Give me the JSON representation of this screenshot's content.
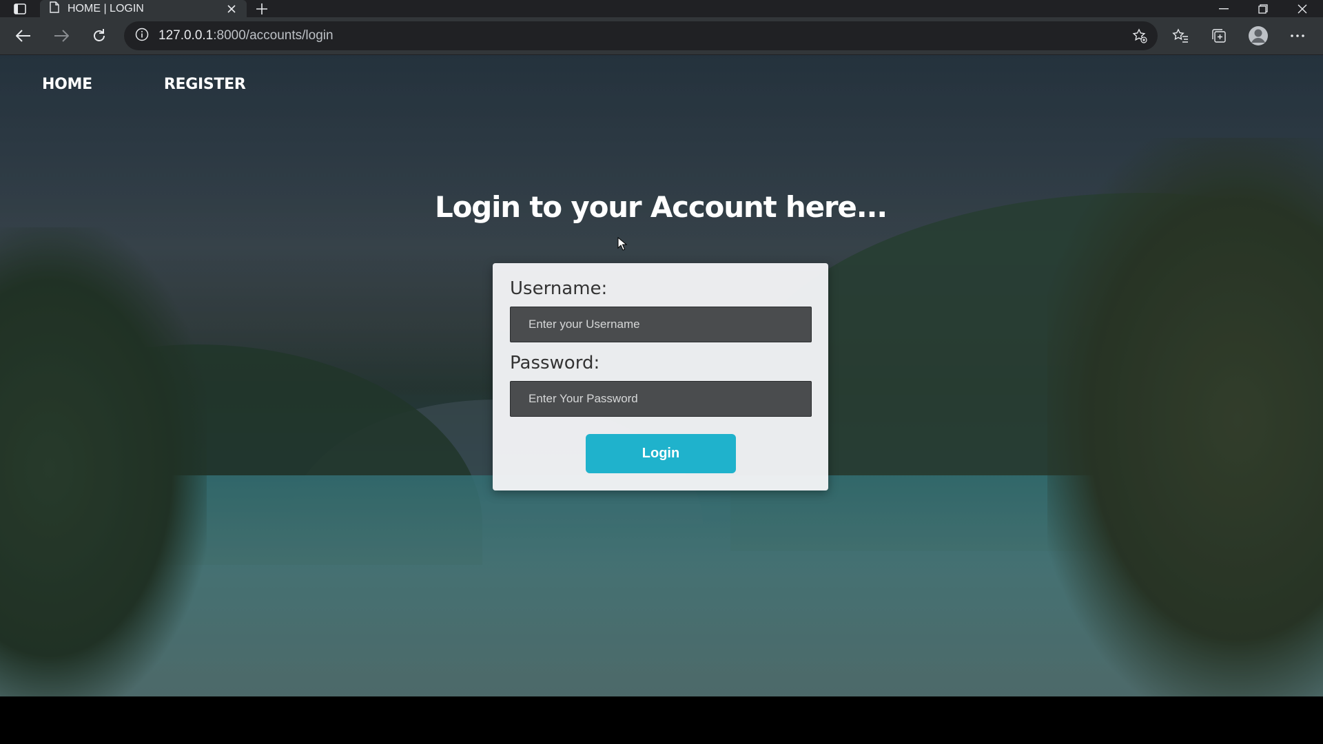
{
  "browser": {
    "tab_title": "HOME | LOGIN",
    "url_host": "127.0.0.1",
    "url_path": ":8000/accounts/login"
  },
  "site": {
    "nav": {
      "home_label": "HOME",
      "register_label": "REGISTER"
    },
    "heading": "Login to your Account here...",
    "form": {
      "username_label": "Username:",
      "username_placeholder": "Enter your Username",
      "password_label": "Password:",
      "password_placeholder": "Enter Your Password",
      "submit_label": "Login"
    }
  },
  "colors": {
    "login_button": "#1fb2cc",
    "input_background": "#4a4c4e",
    "browser_chrome": "#323639"
  },
  "icons": [
    "tab-actions-icon",
    "page-icon",
    "close-icon",
    "plus-icon",
    "minimize-icon",
    "restore-icon",
    "window-close-icon",
    "back-icon",
    "forward-icon",
    "refresh-icon",
    "info-icon",
    "add-favorite-icon",
    "favorites-icon",
    "collections-icon",
    "profile-icon",
    "more-icon",
    "cursor-icon"
  ]
}
